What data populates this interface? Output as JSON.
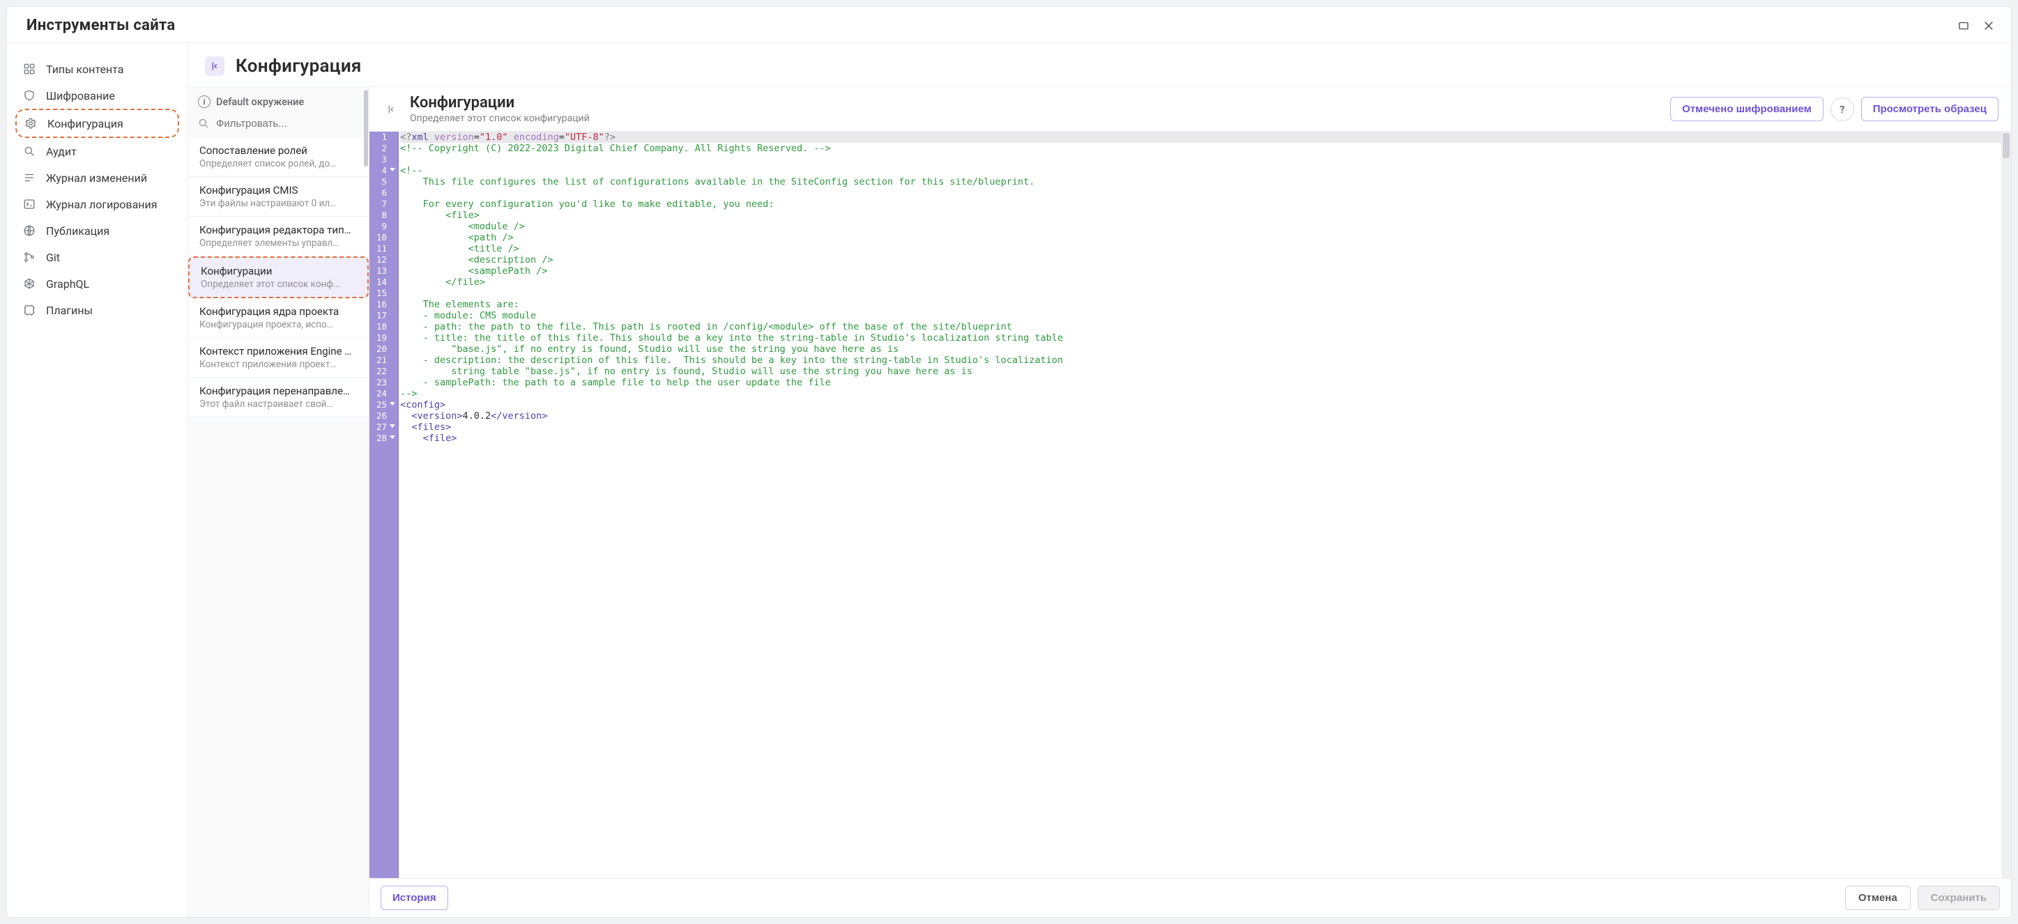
{
  "window": {
    "title": "Инструменты сайта"
  },
  "sidenav": {
    "items": [
      {
        "label": "Типы контента",
        "icon": "grid-icon"
      },
      {
        "label": "Шифрование",
        "icon": "shield-icon"
      },
      {
        "label": "Конфигурация",
        "icon": "gear-icon",
        "highlight": true
      },
      {
        "label": "Аудит",
        "icon": "magnify-icon"
      },
      {
        "label": "Журнал изменений",
        "icon": "list-icon"
      },
      {
        "label": "Журнал логирования",
        "icon": "terminal-icon"
      },
      {
        "label": "Публикация",
        "icon": "globe-icon"
      },
      {
        "label": "Git",
        "icon": "git-icon"
      },
      {
        "label": "GraphQL",
        "icon": "graphql-icon"
      },
      {
        "label": "Плагины",
        "icon": "plugin-icon"
      }
    ]
  },
  "main": {
    "title": "Конфигурация"
  },
  "configPanel": {
    "envLabel": "Default окружение",
    "filterPlaceholder": "Фильтровать...",
    "items": [
      {
        "title": "Сопоставление ролей",
        "desc": "Определяет список ролей, до…"
      },
      {
        "title": "Конфигурация CMIS",
        "desc": "Эти файлы настраивают 0 ил…"
      },
      {
        "title": "Конфигурация редактора тип…",
        "desc": "Определяет элементы управл…"
      },
      {
        "title": "Конфигурации",
        "desc": "Определяет этот список конф…",
        "selected": true,
        "highlight": true
      },
      {
        "title": "Конфигурация ядра проекта",
        "desc": "Конфигурация проекта, испо…"
      },
      {
        "title": "Контекст приложения Engine …",
        "desc": "Контекст приложения проект…"
      },
      {
        "title": "Конфигурация перенаправле…",
        "desc": "Этот файл настраивает свой…"
      }
    ]
  },
  "editor": {
    "title": "Конфигурации",
    "subtitle": "Определяет этот список конфигураций",
    "actions": {
      "encryptLabel": "Отмечено шифрованием",
      "sampleLabel": "Просмотреть образец"
    },
    "code": {
      "lines": [
        {
          "n": 1,
          "first": true,
          "html": "<span class='tok-pi'>&lt;?</span><span class='tok-tag'>xml</span> <span class='tok-attr'>version</span>=<span class='tok-str'>\"1.0\"</span> <span class='tok-attr'>encoding</span>=<span class='tok-str'>\"UTF-8\"</span><span class='tok-pi'>?&gt;</span>"
        },
        {
          "n": 2,
          "html": "<span class='tok-com'>&lt;!-- Copyright (C) 2022-2023 Digital Chief Company. All Rights Reserved. --&gt;</span>"
        },
        {
          "n": 3,
          "html": ""
        },
        {
          "n": 4,
          "fold": true,
          "html": "<span class='tok-com'>&lt;!--</span>"
        },
        {
          "n": 5,
          "html": "<span class='tok-com'>    This file configures the list of configurations available in the SiteConfig section for this site/blueprint.</span>"
        },
        {
          "n": 6,
          "html": ""
        },
        {
          "n": 7,
          "html": "<span class='tok-com'>    For every configuration you'd like to make editable, you need:</span>"
        },
        {
          "n": 8,
          "html": "<span class='tok-com'>        &lt;file&gt;</span>"
        },
        {
          "n": 9,
          "html": "<span class='tok-com'>            &lt;module /&gt;</span>"
        },
        {
          "n": 10,
          "html": "<span class='tok-com'>            &lt;path /&gt;</span>"
        },
        {
          "n": 11,
          "html": "<span class='tok-com'>            &lt;title /&gt;</span>"
        },
        {
          "n": 12,
          "html": "<span class='tok-com'>            &lt;description /&gt;</span>"
        },
        {
          "n": 13,
          "html": "<span class='tok-com'>            &lt;samplePath /&gt;</span>"
        },
        {
          "n": 14,
          "html": "<span class='tok-com'>        &lt;/file&gt;</span>"
        },
        {
          "n": 15,
          "html": ""
        },
        {
          "n": 16,
          "html": "<span class='tok-com'>    The elements are:</span>"
        },
        {
          "n": 17,
          "html": "<span class='tok-com'>    - module: CMS module</span>"
        },
        {
          "n": 18,
          "html": "<span class='tok-com'>    - path: the path to the file. This path is rooted in /config/&lt;module&gt; off the base of the site/blueprint</span>"
        },
        {
          "n": 19,
          "html": "<span class='tok-com'>    - title: the title of this file. This should be a key into the string-table in Studio's localization string table</span>"
        },
        {
          "n": 20,
          "html": "<span class='tok-com'>         \"base.js\", if no entry is found, Studio will use the string you have here as is</span>"
        },
        {
          "n": 21,
          "html": "<span class='tok-com'>    - description: the description of this file.  This should be a key into the string-table in Studio's localization</span>"
        },
        {
          "n": 22,
          "html": "<span class='tok-com'>         string table \"base.js\", if no entry is found, Studio will use the string you have here as is</span>"
        },
        {
          "n": 23,
          "html": "<span class='tok-com'>    - samplePath: the path to a sample file to help the user update the file</span>"
        },
        {
          "n": 24,
          "html": "<span class='tok-com'>--&gt;</span>"
        },
        {
          "n": 25,
          "fold": true,
          "html": "<span class='tok-tag'>&lt;config&gt;</span>"
        },
        {
          "n": 26,
          "html": "  <span class='tok-tag'>&lt;version&gt;</span><span class='tok-txt'>4.0.2</span><span class='tok-tag'>&lt;/version&gt;</span>"
        },
        {
          "n": 27,
          "fold": true,
          "html": "  <span class='tok-tag'>&lt;files&gt;</span>"
        },
        {
          "n": 28,
          "fold": true,
          "html": "    <span class='tok-tag'>&lt;file&gt;</span>"
        }
      ]
    },
    "footer": {
      "history": "История",
      "cancel": "Отмена",
      "save": "Сохранить"
    }
  }
}
